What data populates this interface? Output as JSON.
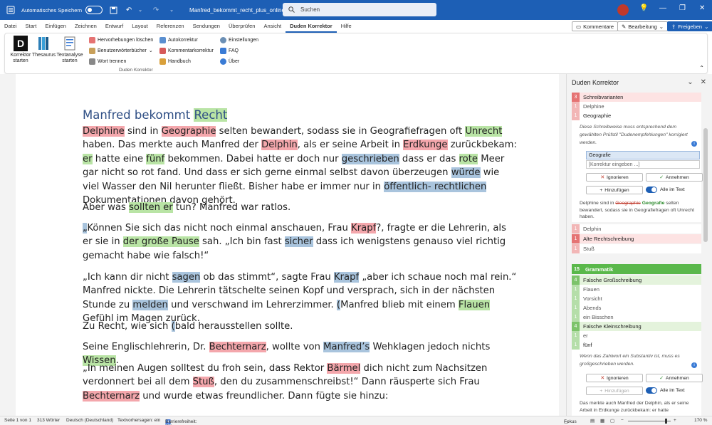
{
  "titlebar": {
    "autosave_label": "Automatisches Speichern",
    "document_title": "Manfred_bekommt_recht_plus_online.docx",
    "search_placeholder": "Suchen"
  },
  "menu": {
    "tabs": [
      "Datei",
      "Start",
      "Einfügen",
      "Zeichnen",
      "Entwurf",
      "Layout",
      "Referenzen",
      "Sendungen",
      "Überprüfen",
      "Ansicht",
      "Duden Korrektor",
      "Hilfe"
    ],
    "comments_label": "Kommentare",
    "editing_label": "Bearbeitung",
    "share_label": "Freigeben"
  },
  "ribbon": {
    "korrektor_label": "Korrektor starten",
    "thesaurus_label": "Thesaurus",
    "textanalyse_label": "Textanalyse starten",
    "hervorhebungen": "Hervorhebungen löschen",
    "benutzerwoerterbuecher": "Benutzerwörterbücher",
    "wort_trennen": "Wort trennen",
    "autokorrektur": "Autokorrektur",
    "kommentarkorrektur": "Kommentarkorrektur",
    "handbuch": "Handbuch",
    "einstellungen": "Einstellungen",
    "faq": "FAQ",
    "ueber": "Über",
    "group_label": "Duden Korrektor"
  },
  "document": {
    "title_a": "Manfred bekommt ",
    "title_b": "Recht"
  },
  "panel": {
    "title": "Duden Korrektor",
    "schreibvarianten": {
      "count": "3",
      "label": "Schreibvarianten"
    },
    "delphine": {
      "count": "1",
      "label": "Delphine"
    },
    "geographie": {
      "count": "1",
      "label": "Geographie"
    },
    "hint1": "Diese Schreibweise muss entsprechend dem gewählten Prüfstil \"Dudenempfehlungen\" korrigiert werden.",
    "suggestion": "Geografie",
    "custom_placeholder": "[Korrektur eingeben ...]",
    "ignore": "Ignorieren",
    "accept": "Annehmen",
    "add": "Hinzufügen",
    "all_in_text": "Alle im Text",
    "context1_a": "Delphine sind in ",
    "context1_old": "Geographie",
    "context1_new": "Geografie",
    "context1_b": " selten bewandert, sodass sie in Geografiefragen oft Unrecht haben.",
    "delphin": {
      "count": "1",
      "label": "Delphin"
    },
    "alte_rs": {
      "count": "1",
      "label": "Alte Rechtschreibung"
    },
    "stuss": {
      "count": "1",
      "label": "Stuß"
    },
    "grammatik": {
      "count": "15",
      "label": "Grammatik"
    },
    "falsche_gross": {
      "count": "4",
      "label": "Falsche Großschreibung"
    },
    "flauen": {
      "count": "1",
      "label": "Flauen"
    },
    "vorsicht": {
      "count": "1",
      "label": "Vorsicht"
    },
    "abends": {
      "count": "1",
      "label": "Abends"
    },
    "bisschen": {
      "count": "1",
      "label": "ein Bisschen"
    },
    "falsche_klein": {
      "count": "4",
      "label": "Falsche Kleinschreibung"
    },
    "er": {
      "count": "1",
      "label": "er"
    },
    "fuenf": {
      "count": "1",
      "label": "fünf"
    },
    "hint2": "Wenn das Zahlwort ein Substantiv ist, muss es großgeschrieben werden.",
    "context2": "Das merkte auch Manfred der Delphin, als er seine Arbeit in Erdkunge zurückbekam: er hatte"
  },
  "status": {
    "page": "Seite 1 von 1",
    "words": "313 Wörter",
    "language": "Deutsch (Deutschland)",
    "text_prediction": "Textvorhersagen: ein",
    "accessibility": "Barrierefreiheit: Keine Probleme",
    "focus": "Fokus",
    "zoom": "170 %"
  },
  "colors": {
    "brand": "#1d5fb5",
    "error_red": "#f4a7ac",
    "grammar_green": "#b9e4a5",
    "style_blue": "#a9c4dd"
  }
}
